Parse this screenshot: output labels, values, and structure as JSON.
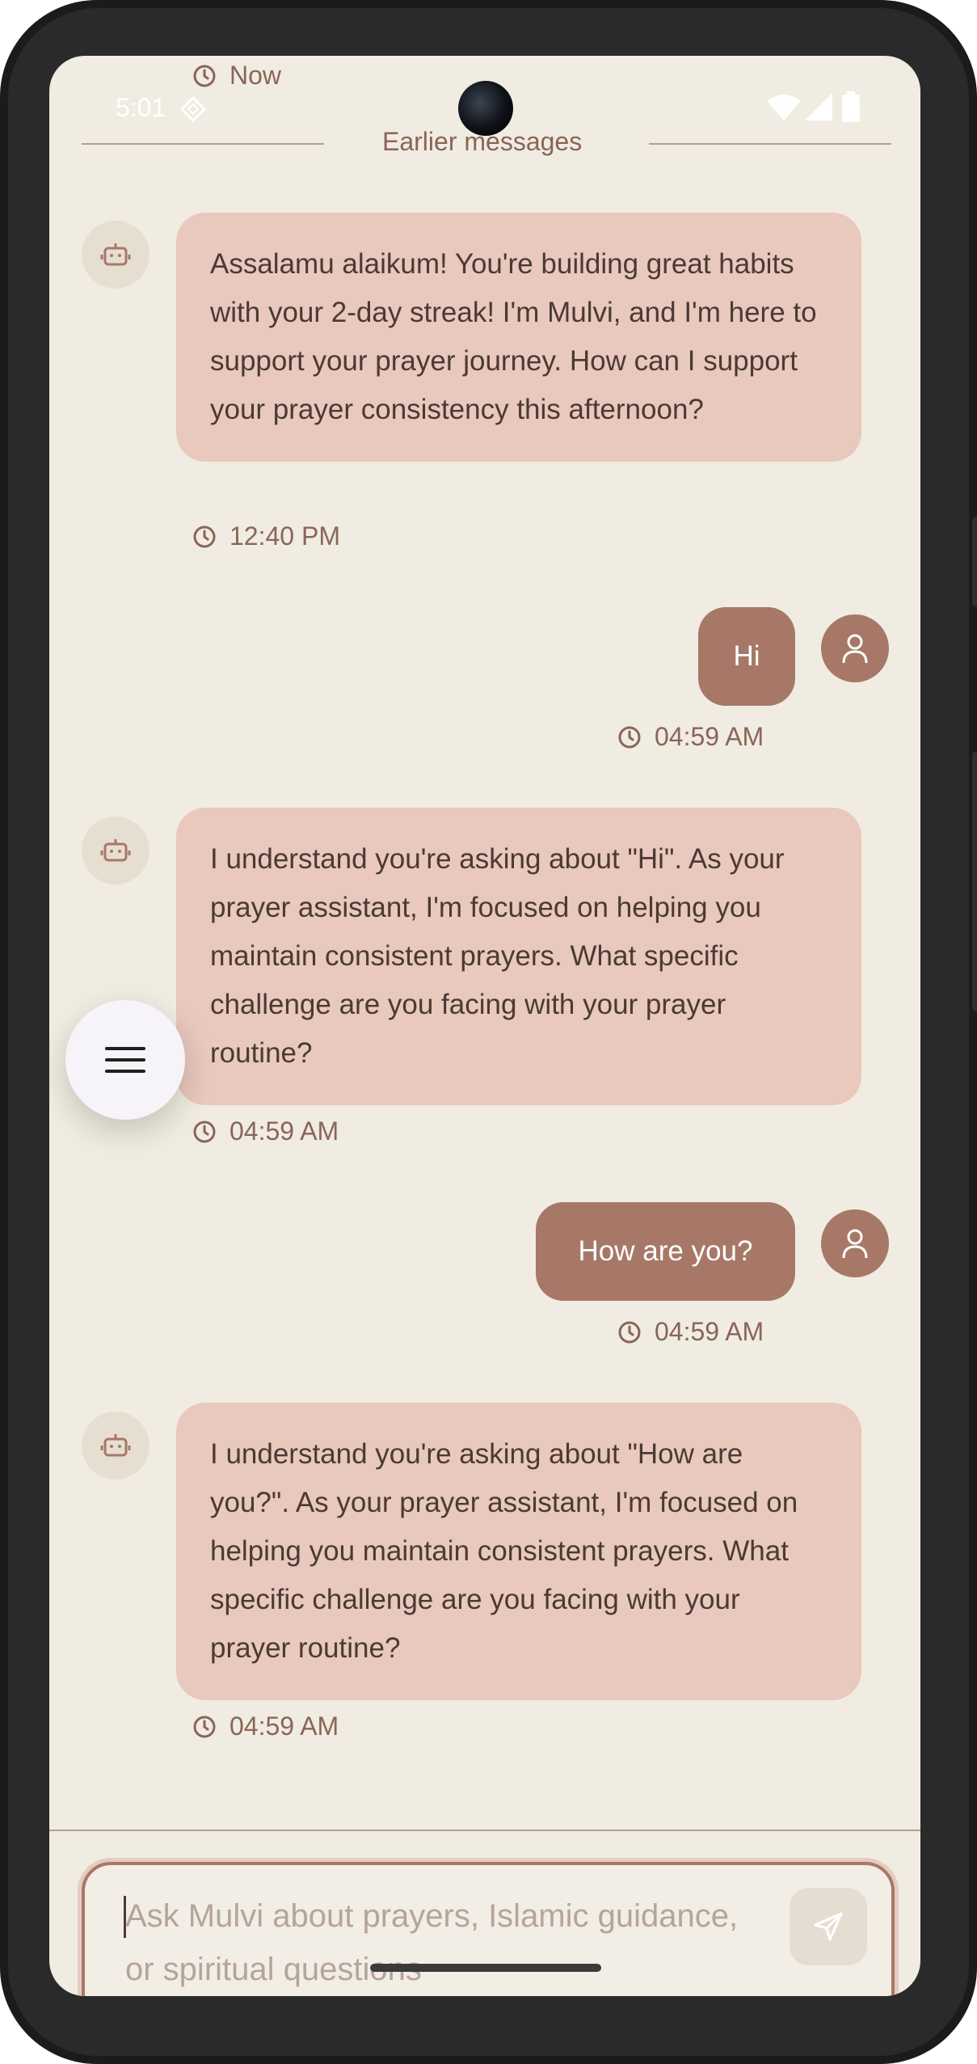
{
  "status_bar": {
    "time": "5:01"
  },
  "history_divider": {
    "label": "Earlier messages"
  },
  "top_timestamp": "Now",
  "messages": [
    {
      "sender": "bot",
      "text": "Assalamu alaikum! You're building great habits with your 2-day streak! I'm Mulvi, and I'm here to support your prayer journey. How can I support your prayer consistency this afternoon?",
      "time": "12:40 PM"
    },
    {
      "sender": "user",
      "text": "Hi",
      "time": "04:59 AM"
    },
    {
      "sender": "bot",
      "text": "I understand you're asking about \"Hi\". As your prayer assistant, I'm focused on helping you maintain consistent prayers. What specific challenge are you facing with your prayer routine?",
      "time": "04:59 AM"
    },
    {
      "sender": "user",
      "text": "How are you?",
      "time": "04:59 AM"
    },
    {
      "sender": "bot",
      "text": "I understand you're asking about \"How are you?\". As your prayer assistant, I'm focused on helping you maintain consistent prayers. What specific challenge are you facing with your prayer routine?",
      "time": "04:59 AM"
    }
  ],
  "composer": {
    "placeholder": "Ask Mulvi about prayers, Islamic guidance, or spiritual questions"
  },
  "icons": {
    "bot": "robot-icon",
    "user": "person-icon",
    "clock": "clock-icon",
    "menu": "menu-icon",
    "send": "send-icon"
  },
  "colors": {
    "background": "#f0ece1",
    "bot_bubble": "#e9c8bd",
    "user_bubble": "#a77868",
    "accent_text": "#8a6558"
  }
}
